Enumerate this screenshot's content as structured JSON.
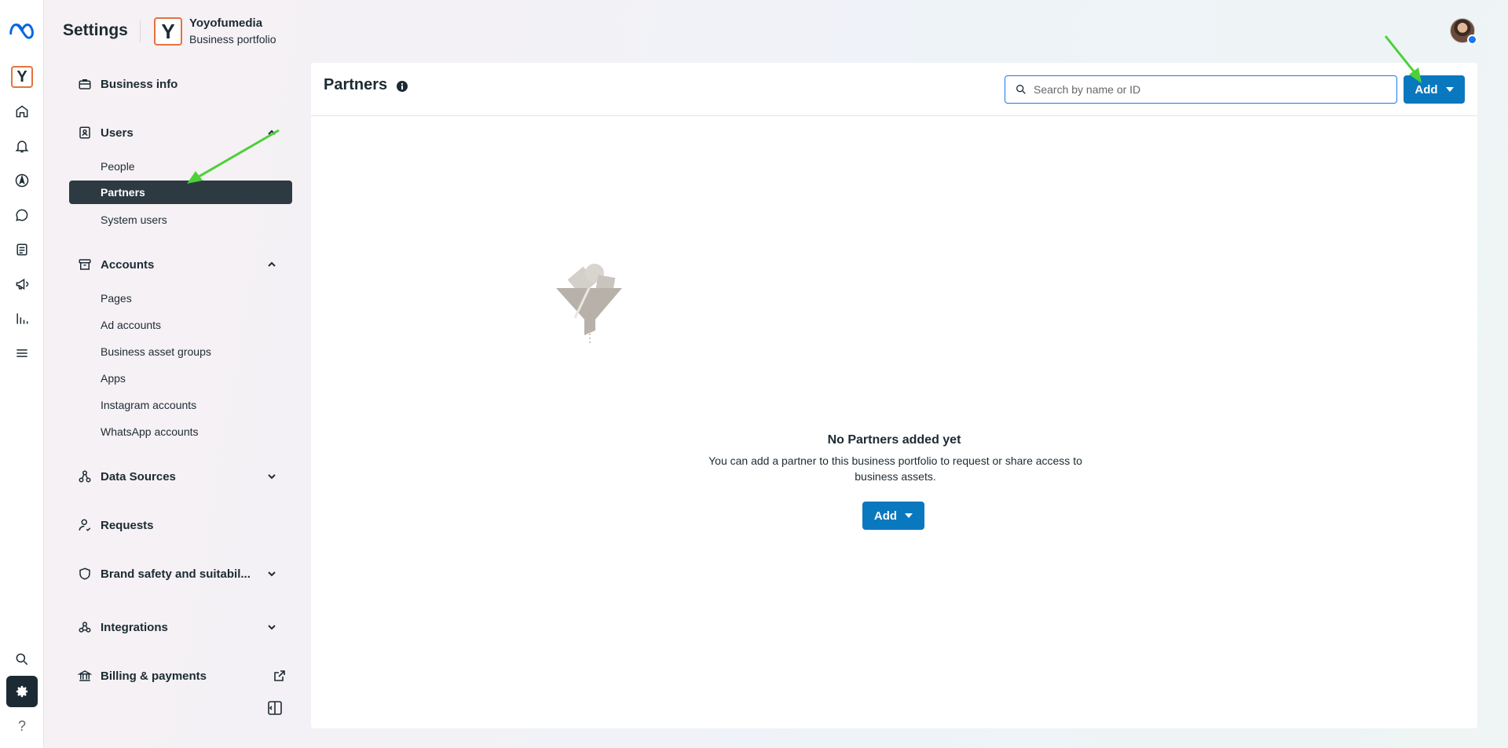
{
  "header": {
    "app_title": "Settings",
    "portfolio_initial": "Y",
    "portfolio_name": "Yoyofumedia",
    "portfolio_type": "Business portfolio"
  },
  "rail": {
    "brand_initial": "Y",
    "items": [
      "home-icon",
      "bell-icon",
      "compass-icon",
      "chat-icon",
      "pages-icon",
      "megaphone-icon",
      "chart-icon",
      "menu-icon",
      "search-icon",
      "gear-icon",
      "help-icon"
    ],
    "help_label": "?"
  },
  "nav": {
    "business_info": "Business info",
    "users": "Users",
    "people": "People",
    "partners": "Partners",
    "system_users": "System users",
    "accounts": "Accounts",
    "pages": "Pages",
    "ad_accounts": "Ad accounts",
    "business_asset_groups": "Business asset groups",
    "apps": "Apps",
    "instagram_accounts": "Instagram accounts",
    "whatsapp_accounts": "WhatsApp accounts",
    "data_sources": "Data Sources",
    "requests": "Requests",
    "brand_safety": "Brand safety and suitabil...",
    "integrations": "Integrations",
    "billing": "Billing & payments"
  },
  "main": {
    "title": "Partners",
    "search_placeholder": "Search by name or ID",
    "add_label": "Add",
    "empty_title": "No Partners added yet",
    "empty_desc": "You can add a partner to this business portfolio to request or share access to business assets.",
    "empty_add_label": "Add"
  },
  "colors": {
    "primary_button": "#0a78be",
    "active_nav": "#2d3a41",
    "annotation_arrow": "#4cd137",
    "brand_accent": "#e7723c"
  }
}
